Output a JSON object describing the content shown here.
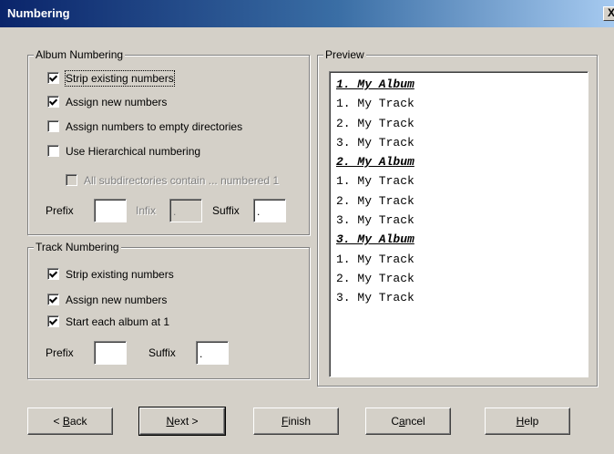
{
  "window": {
    "title": "Numbering",
    "close_label": "X"
  },
  "album_numbering": {
    "legend": "Album Numbering",
    "options": [
      {
        "label": "Strip existing numbers",
        "checked": true,
        "enabled": true
      },
      {
        "label": "Assign new numbers",
        "checked": true,
        "enabled": true
      },
      {
        "label": "Assign numbers to empty directories",
        "checked": false,
        "enabled": true
      },
      {
        "label": "Use Hierarchical numbering",
        "checked": false,
        "enabled": true
      },
      {
        "label": "All subdirectories contain ... numbered 1",
        "checked": false,
        "enabled": false
      }
    ],
    "prefix_label": "Prefix",
    "prefix_value": "",
    "infix_label": "Infix",
    "infix_value": ".",
    "suffix_label": "Suffix",
    "suffix_value": "."
  },
  "track_numbering": {
    "legend": "Track Numbering",
    "options": [
      {
        "label": "Strip existing numbers",
        "checked": true
      },
      {
        "label": "Assign new numbers",
        "checked": true
      },
      {
        "label": "Start each album at 1",
        "checked": true
      }
    ],
    "prefix_label": "Prefix",
    "prefix_value": "",
    "suffix_label": "Suffix",
    "suffix_value": "."
  },
  "preview": {
    "legend": "Preview",
    "lines": [
      {
        "text": "1. My Album",
        "album": true
      },
      {
        "text": "1. My Track",
        "album": false
      },
      {
        "text": "2. My Track",
        "album": false
      },
      {
        "text": "3. My Track",
        "album": false
      },
      {
        "text": "2. My Album",
        "album": true
      },
      {
        "text": "1. My Track",
        "album": false
      },
      {
        "text": "2. My Track",
        "album": false
      },
      {
        "text": "3. My Track",
        "album": false
      },
      {
        "text": "3. My Album",
        "album": true
      },
      {
        "text": "1. My Track",
        "album": false
      },
      {
        "text": "2. My Track",
        "album": false
      },
      {
        "text": "3. My Track",
        "album": false
      }
    ]
  },
  "buttons": {
    "back": "< Back",
    "next": "Next >",
    "finish": "Finish",
    "cancel": "Cancel",
    "help": "Help"
  }
}
